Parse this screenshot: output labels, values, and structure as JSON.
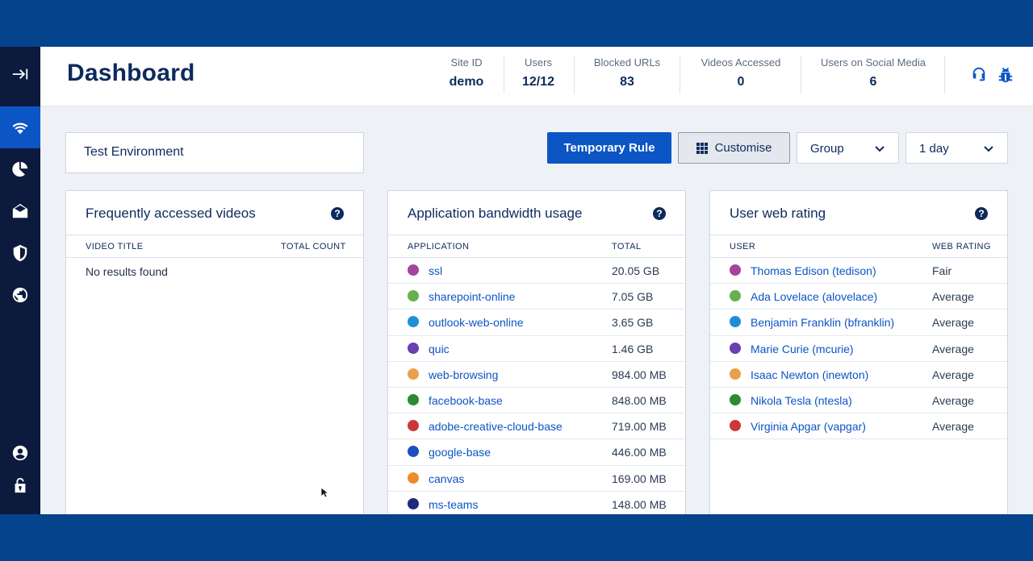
{
  "header": {
    "title": "Dashboard",
    "stats": [
      {
        "label": "Site ID",
        "value": "demo"
      },
      {
        "label": "Users",
        "value": "12/12"
      },
      {
        "label": "Blocked URLs",
        "value": "83"
      },
      {
        "label": "Videos Accessed",
        "value": "0"
      },
      {
        "label": "Users on Social Media",
        "value": "6"
      }
    ],
    "icons": [
      "headset-icon",
      "bug-icon"
    ]
  },
  "sidebar": {
    "items": [
      {
        "icon": "expand-icon"
      },
      {
        "icon": "wifi-icon",
        "active": true
      },
      {
        "icon": "pie-chart-icon"
      },
      {
        "icon": "envelope-icon"
      },
      {
        "icon": "shield-icon"
      },
      {
        "icon": "globe-icon"
      },
      {
        "icon": "user-icon"
      },
      {
        "icon": "lock-icon"
      }
    ]
  },
  "toolbar": {
    "environment": "Test Environment",
    "temporary_rule": "Temporary Rule",
    "customise": "Customise",
    "group": "Group",
    "period": "1 day"
  },
  "panels": {
    "videos": {
      "title": "Frequently accessed videos",
      "col1": "VIDEO TITLE",
      "col2": "TOTAL COUNT",
      "empty": "No results found"
    },
    "bandwidth": {
      "title": "Application bandwidth usage",
      "col1": "APPLICATION",
      "col2": "TOTAL",
      "rows": [
        {
          "name": "ssl",
          "total": "20.05 GB",
          "color": "#a4449c"
        },
        {
          "name": "sharepoint-online",
          "total": "7.05 GB",
          "color": "#66b04e"
        },
        {
          "name": "outlook-web-online",
          "total": "3.65 GB",
          "color": "#1e8fd6"
        },
        {
          "name": "quic",
          "total": "1.46 GB",
          "color": "#6a3fb0"
        },
        {
          "name": "web-browsing",
          "total": "984.00 MB",
          "color": "#e9a04a"
        },
        {
          "name": "facebook-base",
          "total": "848.00 MB",
          "color": "#2c8a30"
        },
        {
          "name": "adobe-creative-cloud-base",
          "total": "719.00 MB",
          "color": "#cc3838"
        },
        {
          "name": "google-base",
          "total": "446.00 MB",
          "color": "#1a4fc0"
        },
        {
          "name": "canvas",
          "total": "169.00 MB",
          "color": "#ef8a2c"
        },
        {
          "name": "ms-teams",
          "total": "148.00 MB",
          "color": "#1f2a7a"
        }
      ]
    },
    "rating": {
      "title": "User web rating",
      "col1": "USER",
      "col2": "WEB RATING",
      "rows": [
        {
          "name": "Thomas Edison (tedison)",
          "rating": "Fair",
          "color": "#a4449c"
        },
        {
          "name": "Ada Lovelace (alovelace)",
          "rating": "Average",
          "color": "#66b04e"
        },
        {
          "name": "Benjamin Franklin (bfranklin)",
          "rating": "Average",
          "color": "#1e8fd6"
        },
        {
          "name": "Marie Curie (mcurie)",
          "rating": "Average",
          "color": "#6a3fb0"
        },
        {
          "name": "Isaac Newton (inewton)",
          "rating": "Average",
          "color": "#e9a04a"
        },
        {
          "name": "Nikola Tesla (ntesla)",
          "rating": "Average",
          "color": "#2c8a30"
        },
        {
          "name": "Virginia Apgar (vapgar)",
          "rating": "Average",
          "color": "#cc3838"
        }
      ]
    }
  },
  "colors": {
    "frame": "#05438d",
    "sidebar": "#0c1a3d",
    "accent": "#0b55c4",
    "text": "#0e2a5c"
  }
}
